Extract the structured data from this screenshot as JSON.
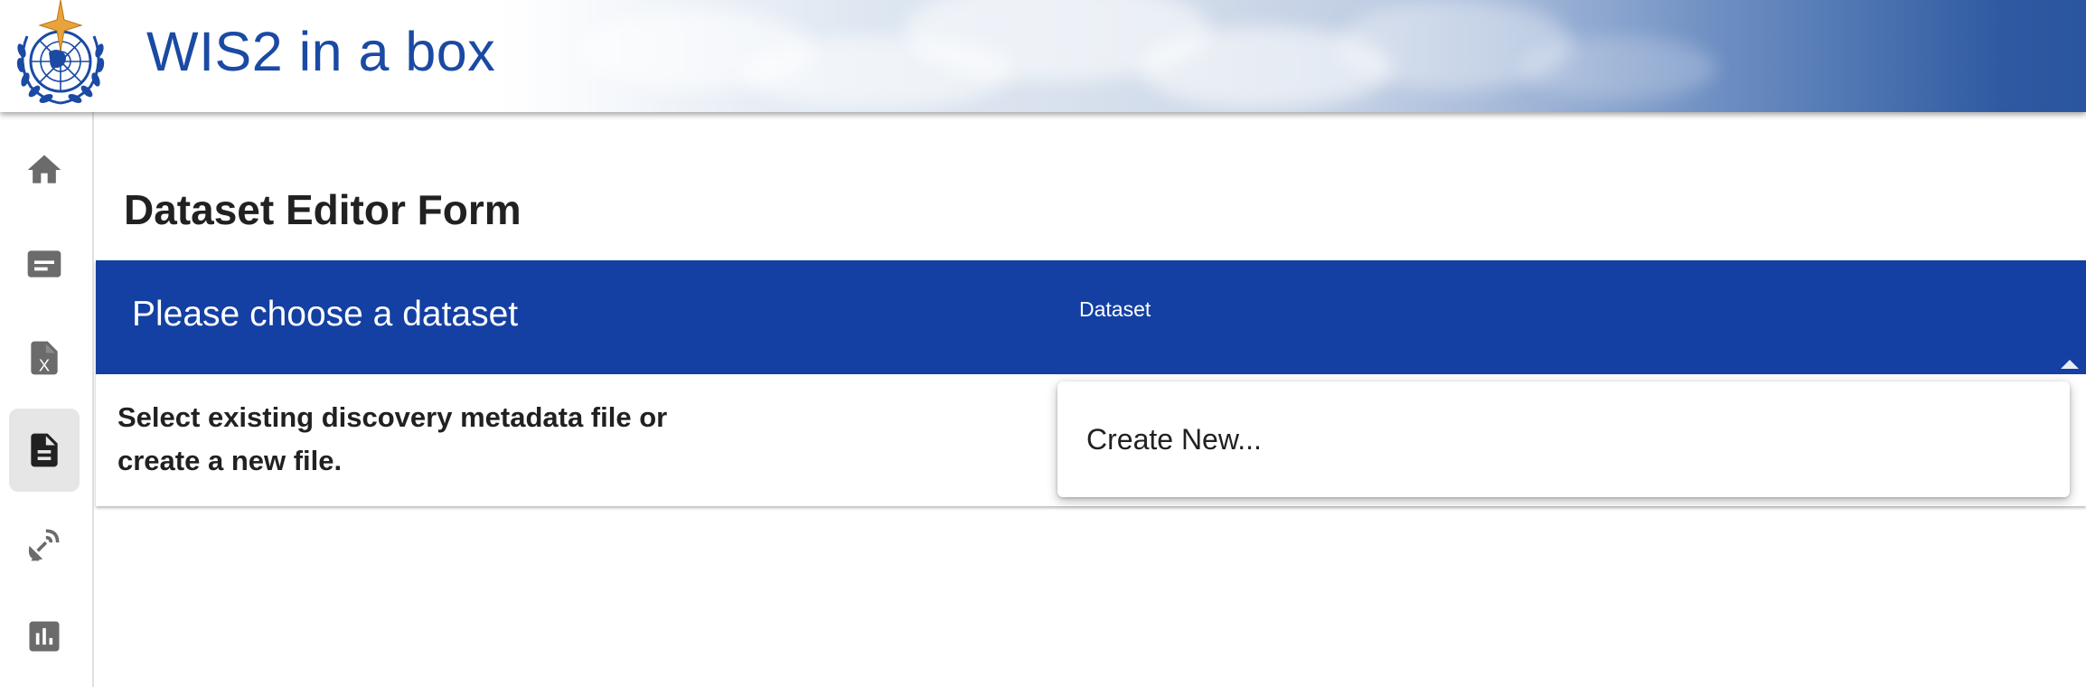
{
  "header": {
    "title": "WIS2 in a box",
    "logo_icon": "wmo-logo-icon"
  },
  "sidebar": {
    "items": [
      {
        "name": "home",
        "icon": "home-icon",
        "active": false
      },
      {
        "name": "messages",
        "icon": "message-card-icon",
        "active": false
      },
      {
        "name": "csv",
        "icon": "file-x-icon",
        "active": false
      },
      {
        "name": "dataset-editor",
        "icon": "document-icon",
        "active": true
      },
      {
        "name": "stations",
        "icon": "satellite-dish-icon",
        "active": false
      },
      {
        "name": "monitoring",
        "icon": "bar-chart-icon",
        "active": false
      }
    ]
  },
  "main": {
    "page_title": "Dataset Editor Form",
    "card": {
      "heading": "Please choose a dataset",
      "description": "Select existing discovery metadata file or create a new file.",
      "select": {
        "label": "Dataset",
        "value": "",
        "options": [
          "Create New..."
        ]
      }
    }
  },
  "colors": {
    "brand_blue": "#1440a3",
    "title_blue": "#1a4aa3",
    "icon_grey": "#6b6b6b",
    "icon_active": "#212121"
  }
}
